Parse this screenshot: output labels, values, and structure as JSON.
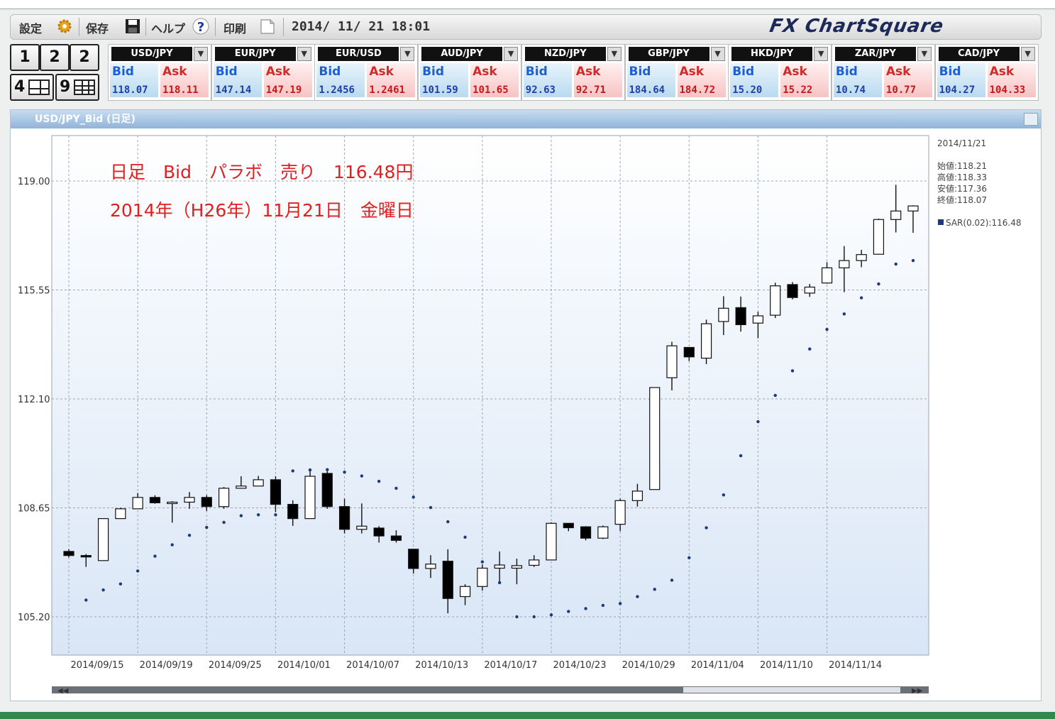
{
  "toolbar": {
    "settings_label": "設定",
    "save_label": "保存",
    "help_label": "ヘルプ",
    "print_label": "印刷",
    "datetime": "2014/ 11/ 21  18:01",
    "logo_text": "FX ChartSquare"
  },
  "layout_buttons": [
    "1",
    "2",
    "2",
    "4",
    "9"
  ],
  "pairs": [
    {
      "name": "USD/JPY",
      "bid": "118.07",
      "ask": "118.11"
    },
    {
      "name": "EUR/JPY",
      "bid": "147.14",
      "ask": "147.19"
    },
    {
      "name": "EUR/USD",
      "bid": "1.2456",
      "ask": "1.2461"
    },
    {
      "name": "AUD/JPY",
      "bid": "101.59",
      "ask": "101.65"
    },
    {
      "name": "NZD/JPY",
      "bid": "92.63",
      "ask": "92.71"
    },
    {
      "name": "GBP/JPY",
      "bid": "184.64",
      "ask": "184.72"
    },
    {
      "name": "HKD/JPY",
      "bid": "15.20",
      "ask": "15.22"
    },
    {
      "name": "ZAR/JPY",
      "bid": "10.74",
      "ask": "10.77"
    },
    {
      "name": "CAD/JPY",
      "bid": "104.27",
      "ask": "104.33"
    }
  ],
  "quote_labels": {
    "bid": "Bid",
    "ask": "Ask"
  },
  "chart_panel": {
    "title": "USD/JPY_Bid (日足)"
  },
  "colors": {
    "bid": "#1f5fd0",
    "ask": "#d02a2a",
    "annotation": "#e02020",
    "sar": "#1a3a7a"
  },
  "chart_data": {
    "type": "candlestick",
    "title": "USD/JPY_Bid (日足)",
    "annotations": [
      "日足　Bid　パラボ　売り　116.48円",
      "2014年（H26年）11月21日　金曜日"
    ],
    "ylim": [
      104.0,
      120.5
    ],
    "y_ticks": [
      105.2,
      108.65,
      112.1,
      115.55,
      119.0
    ],
    "y_tick_labels": [
      "105.20",
      "108.65",
      "112.10",
      "115.55",
      "119.00"
    ],
    "x_tick_labels": [
      "2014/09/15",
      "2014/09/19",
      "2014/09/25",
      "2014/10/01",
      "2014/10/07",
      "2014/10/13",
      "2014/10/17",
      "2014/10/23",
      "2014/10/29",
      "2014/11/04",
      "2014/11/10",
      "2014/11/14"
    ],
    "grid": true,
    "info": {
      "date": "2014/11/21",
      "open": "始値:118.21",
      "high": "高値:118.33",
      "low": "安値:117.36",
      "close": "終値:118.07",
      "sar_label": "SAR(0.02):116.48"
    },
    "candles": [
      [
        107.27,
        107.34,
        107.08,
        107.14
      ],
      [
        107.14,
        107.19,
        106.78,
        107.11
      ],
      [
        106.98,
        108.31,
        106.98,
        108.31
      ],
      [
        108.31,
        108.65,
        108.31,
        108.62
      ],
      [
        108.62,
        109.12,
        108.62,
        108.98
      ],
      [
        108.98,
        109.05,
        108.78,
        108.81
      ],
      [
        108.81,
        108.86,
        108.18,
        108.83
      ],
      [
        108.83,
        109.15,
        108.62,
        108.98
      ],
      [
        108.98,
        109.05,
        108.55,
        108.69
      ],
      [
        108.69,
        109.31,
        108.62,
        109.27
      ],
      [
        109.27,
        109.65,
        109.27,
        109.34
      ],
      [
        109.34,
        109.66,
        109.34,
        109.54
      ],
      [
        109.54,
        109.65,
        108.52,
        108.76
      ],
      [
        108.76,
        108.89,
        108.08,
        108.31
      ],
      [
        108.31,
        109.88,
        108.31,
        109.65
      ],
      [
        109.74,
        109.81,
        108.62,
        108.69
      ],
      [
        108.69,
        108.94,
        107.84,
        107.97
      ],
      [
        107.97,
        108.79,
        107.84,
        108.07
      ],
      [
        108.01,
        108.07,
        107.55,
        107.76
      ],
      [
        107.76,
        107.94,
        107.55,
        107.62
      ],
      [
        107.34,
        107.34,
        106.57,
        106.73
      ],
      [
        106.73,
        107.15,
        106.43,
        106.87
      ],
      [
        106.96,
        107.34,
        105.31,
        105.78
      ],
      [
        105.84,
        106.23,
        105.57,
        106.16
      ],
      [
        106.16,
        106.86,
        106.03,
        106.74
      ],
      [
        106.74,
        107.27,
        106.3,
        106.84
      ],
      [
        106.74,
        107.04,
        106.23,
        106.82
      ],
      [
        106.83,
        107.15,
        106.78,
        107.0
      ],
      [
        107.0,
        108.19,
        107.0,
        108.16
      ],
      [
        108.16,
        108.16,
        107.91,
        108.02
      ],
      [
        108.05,
        108.07,
        107.62,
        107.69
      ],
      [
        107.69,
        108.09,
        107.66,
        108.05
      ],
      [
        108.13,
        108.94,
        107.91,
        108.88
      ],
      [
        108.88,
        109.41,
        108.69,
        109.18
      ],
      [
        109.23,
        112.46,
        109.23,
        112.46
      ],
      [
        112.77,
        113.91,
        112.37,
        113.78
      ],
      [
        113.73,
        113.74,
        113.3,
        113.43
      ],
      [
        113.39,
        114.61,
        113.2,
        114.48
      ],
      [
        114.55,
        115.35,
        114.12,
        114.97
      ],
      [
        114.99,
        115.34,
        114.23,
        114.45
      ],
      [
        114.5,
        114.86,
        114.02,
        114.73
      ],
      [
        114.75,
        115.78,
        114.66,
        115.68
      ],
      [
        115.72,
        115.8,
        115.25,
        115.31
      ],
      [
        115.45,
        115.74,
        115.33,
        115.64
      ],
      [
        115.77,
        116.43,
        115.75,
        116.25
      ],
      [
        116.25,
        116.94,
        115.48,
        116.48
      ],
      [
        116.48,
        116.82,
        116.27,
        116.67
      ],
      [
        116.68,
        117.81,
        116.68,
        117.78
      ],
      [
        117.78,
        118.88,
        117.37,
        118.05
      ],
      [
        118.05,
        118.23,
        117.36,
        118.21
      ]
    ],
    "sar": [
      null,
      105.73,
      106.05,
      106.24,
      106.65,
      107.12,
      107.48,
      107.78,
      108.03,
      108.19,
      108.4,
      108.43,
      108.43,
      109.82,
      109.85,
      109.86,
      109.78,
      109.66,
      109.49,
      109.27,
      108.99,
      108.66,
      108.21,
      107.72,
      106.94,
      106.28,
      105.2,
      105.2,
      105.26,
      105.37,
      105.46,
      105.56,
      105.62,
      105.84,
      106.07,
      106.36,
      107.07,
      108.02,
      109.06,
      110.3,
      111.38,
      112.21,
      112.99,
      113.68,
      114.3,
      114.79,
      115.3,
      115.74,
      116.37,
      116.48
    ]
  }
}
